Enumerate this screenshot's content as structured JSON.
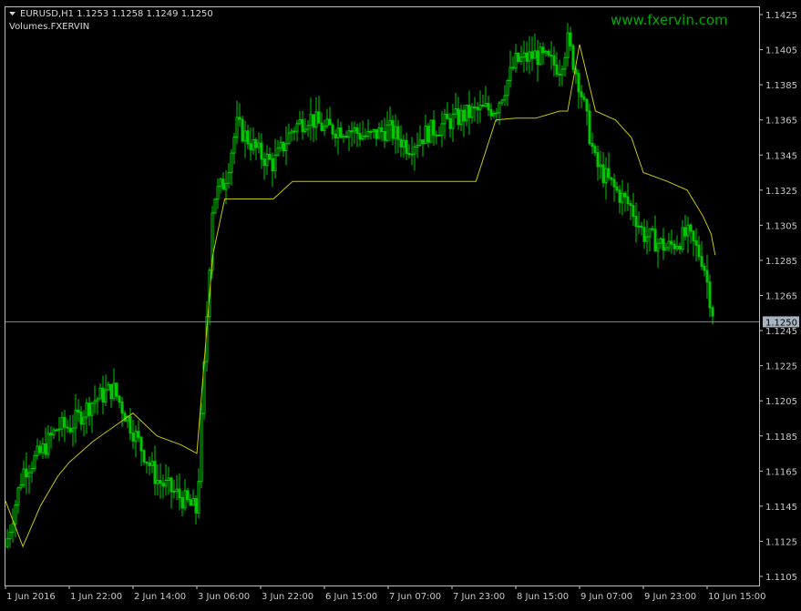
{
  "header": {
    "symbol_line": "EURUSD,H1  1.1253 1.1258 1.1249 1.1250",
    "indicator_label": "Volumes.FXERVIN"
  },
  "watermark": "www.fxervin.com",
  "colors": {
    "background": "#000000",
    "frame": "#c0c0c0",
    "candle": "#00c800",
    "indicator": "#c8c800",
    "price_line": "#6f8fa8",
    "price_tag_bg": "#a8b4c0",
    "watermark": "#00a800"
  },
  "chart_data": {
    "type": "line",
    "title": "",
    "subtitle": "",
    "xlabel": "",
    "ylabel": "",
    "ylim": [
      1.1101,
      1.143
    ],
    "x_ticks": [
      "1 Jun 2016",
      "1 Jun 22:00",
      "2 Jun 14:00",
      "3 Jun 06:00",
      "3 Jun 22:00",
      "6 Jun 15:00",
      "7 Jun 07:00",
      "7 Jun 23:00",
      "8 Jun 15:00",
      "9 Jun 07:00",
      "9 Jun 23:00",
      "10 Jun 15:00"
    ],
    "y_ticks": [
      "1.1425",
      "1.1405",
      "1.1385",
      "1.1365",
      "1.1345",
      "1.1325",
      "1.1305",
      "1.1285",
      "1.1265",
      "1.1245",
      "1.1225",
      "1.1205",
      "1.1185",
      "1.1165",
      "1.1145",
      "1.1125",
      "1.1105"
    ],
    "current_price": "1.1250",
    "grid": false,
    "series": [
      {
        "x": [
          "1 Jun 2016",
          "1 Jun 06:00",
          "1 Jun 12:00",
          "1 Jun 18:00",
          "1 Jun 22:00",
          "2 Jun 04:00",
          "2 Jun 09:00",
          "2 Jun 14:00",
          "2 Jun 20:00",
          "3 Jun 02:00",
          "3 Jun 06:00",
          "3 Jun 10:00",
          "3 Jun 13:00",
          "3 Jun 16:00",
          "3 Jun 22:00",
          "5 Jun 23:00",
          "6 Jun 05:00",
          "6 Jun 10:00",
          "6 Jun 15:00",
          "6 Jun 21:00",
          "7 Jun 02:00",
          "7 Jun 07:00",
          "7 Jun 12:00",
          "7 Jun 17:00",
          "7 Jun 23:00",
          "8 Jun 05:00",
          "8 Jun 10:00",
          "8 Jun 15:00",
          "8 Jun 20:00",
          "9 Jun 02:00",
          "9 Jun 04:00",
          "9 Jun 07:00",
          "9 Jun 11:00",
          "9 Jun 16:00",
          "9 Jun 20:00",
          "9 Jun 23:00",
          "10 Jun 05:00",
          "10 Jun 10:00",
          "10 Jun 14:00",
          "10 Jun 16:00",
          "10 Jun 17:00"
        ],
        "values": [
          1.1122,
          1.1165,
          1.1175,
          1.119,
          1.119,
          1.1205,
          1.1212,
          1.1188,
          1.116,
          1.115,
          1.1142,
          1.132,
          1.133,
          1.1362,
          1.1345,
          1.134,
          1.136,
          1.1367,
          1.136,
          1.136,
          1.1355,
          1.136,
          1.135,
          1.1358,
          1.1365,
          1.137,
          1.1372,
          1.1398,
          1.1402,
          1.1395,
          1.141,
          1.1385,
          1.134,
          1.1325,
          1.1315,
          1.13,
          1.1292,
          1.13,
          1.1285,
          1.126,
          1.125
        ]
      },
      {
        "x": [
          "1 Jun 2016",
          "1 Jun 06:00",
          "1 Jun 12:00",
          "1 Jun 18:00",
          "1 Jun 22:00",
          "2 Jun 04:00",
          "2 Jun 09:00",
          "2 Jun 14:00",
          "2 Jun 20:00",
          "3 Jun 02:00",
          "3 Jun 06:00",
          "3 Jun 10:00",
          "3 Jun 13:00",
          "3 Jun 16:00",
          "3 Jun 22:00",
          "5 Jun 23:00",
          "6 Jun 05:00",
          "6 Jun 10:00",
          "6 Jun 15:00",
          "6 Jun 21:00",
          "7 Jun 02:00",
          "7 Jun 07:00",
          "7 Jun 12:00",
          "7 Jun 17:00",
          "7 Jun 23:00",
          "8 Jun 05:00",
          "8 Jun 10:00",
          "8 Jun 15:00",
          "8 Jun 20:00",
          "9 Jun 02:00",
          "9 Jun 04:00",
          "9 Jun 07:00",
          "9 Jun 11:00",
          "9 Jun 16:00",
          "9 Jun 20:00",
          "9 Jun 23:00",
          "10 Jun 05:00",
          "10 Jun 10:00",
          "10 Jun 14:00",
          "10 Jun 16:00",
          "10 Jun 17:00"
        ],
        "values": [
          1.1148,
          1.1122,
          1.1145,
          1.1162,
          1.117,
          1.1182,
          1.119,
          1.1198,
          1.1185,
          1.118,
          1.1175,
          1.1288,
          1.132,
          1.132,
          1.132,
          1.132,
          1.133,
          1.133,
          1.133,
          1.133,
          1.133,
          1.133,
          1.133,
          1.133,
          1.133,
          1.133,
          1.1365,
          1.1366,
          1.1366,
          1.137,
          1.137,
          1.1408,
          1.137,
          1.1365,
          1.1355,
          1.1335,
          1.133,
          1.1325,
          1.131,
          1.13,
          1.1288
        ]
      }
    ]
  }
}
